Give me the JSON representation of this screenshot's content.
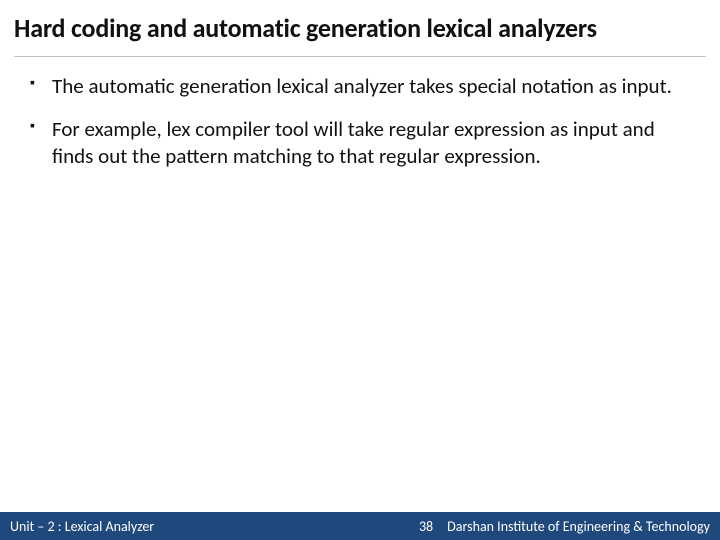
{
  "title": "Hard coding and automatic generation lexical analyzers",
  "bullets": [
    "The automatic generation lexical analyzer takes special notation as input.",
    "For example, lex compiler tool will take regular expression as input and finds out the pattern matching to that regular expression."
  ],
  "footer": {
    "unit": "Unit – 2  : Lexical Analyzer",
    "page": "38",
    "institute": "Darshan Institute of Engineering & Technology"
  }
}
